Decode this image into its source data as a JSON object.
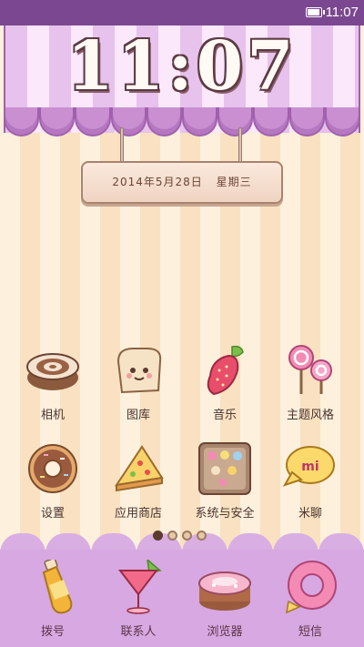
{
  "status_bar": {
    "time": "11:07",
    "icons": [
      "battery-icon"
    ]
  },
  "clock": {
    "time": "11:07"
  },
  "date_sign": {
    "date": "2014年5月28日",
    "weekday": "星期三"
  },
  "apps": [
    {
      "label": "相机",
      "icon": "camera-roll-cake-icon"
    },
    {
      "label": "图库",
      "icon": "gallery-toast-icon"
    },
    {
      "label": "音乐",
      "icon": "music-strawberry-icon"
    },
    {
      "label": "主题风格",
      "icon": "themes-lollipop-icon"
    },
    {
      "label": "设置",
      "icon": "settings-donut-icon"
    },
    {
      "label": "应用商店",
      "icon": "app-store-pizza-icon"
    },
    {
      "label": "系统与安全",
      "icon": "security-cookie-tray-icon"
    },
    {
      "label": "米聊",
      "icon": "miliao-chat-bubble-icon"
    }
  ],
  "pager": {
    "pages": 4,
    "active": 1
  },
  "dock": [
    {
      "label": "拨号",
      "icon": "phone-bottle-icon"
    },
    {
      "label": "联系人",
      "icon": "contacts-cocktail-icon"
    },
    {
      "label": "浏览器",
      "icon": "browser-cake-icon"
    },
    {
      "label": "短信",
      "icon": "messages-donut-icon"
    }
  ]
}
